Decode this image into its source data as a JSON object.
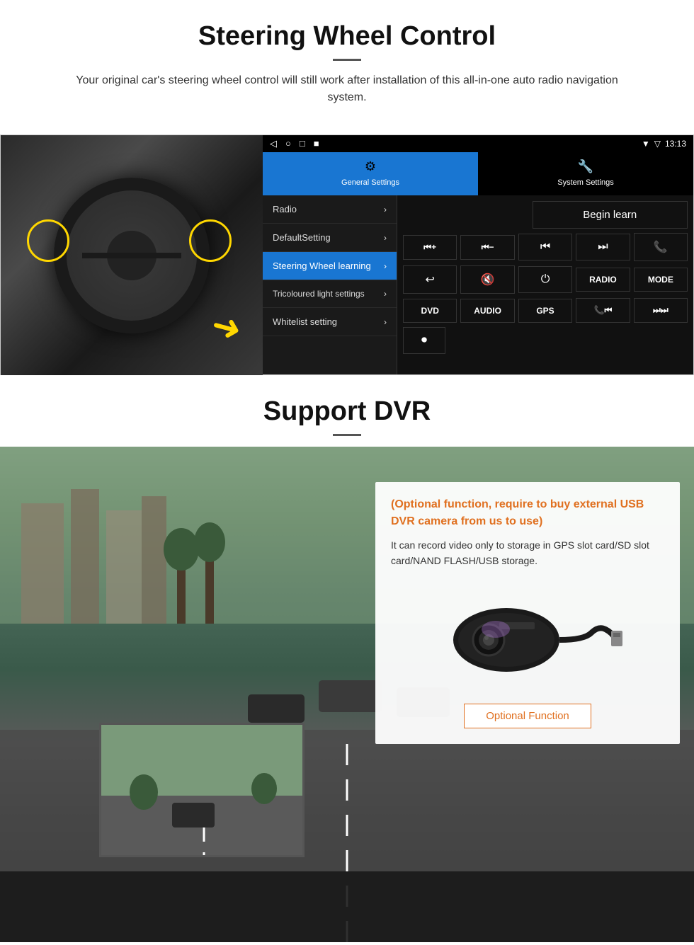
{
  "page": {
    "section1": {
      "title": "Steering Wheel Control",
      "subtitle": "Your original car's steering wheel control will still work after installation of this all-in-one auto radio navigation system.",
      "status_bar": {
        "time": "13:13",
        "nav_icons": [
          "◁",
          "○",
          "□",
          "■"
        ]
      },
      "tabs": [
        {
          "label": "General Settings",
          "icon": "⚙",
          "active": true
        },
        {
          "label": "System Settings",
          "icon": "🔧",
          "active": false
        }
      ],
      "menu_items": [
        {
          "label": "Radio",
          "active": false
        },
        {
          "label": "DefaultSetting",
          "active": false
        },
        {
          "label": "Steering Wheel learning",
          "active": true
        },
        {
          "label": "Tricoloured light settings",
          "active": false
        },
        {
          "label": "Whitelist setting",
          "active": false
        }
      ],
      "begin_learn_label": "Begin learn",
      "control_buttons": [
        [
          "⏮+",
          "⏮−",
          "⏮⏮",
          "⏭⏭",
          "📞"
        ],
        [
          "↩",
          "🔇",
          "⏻",
          "RADIO",
          "MODE"
        ],
        [
          "DVD",
          "AUDIO",
          "GPS",
          "📞⏮",
          "⏭⏭"
        ]
      ]
    },
    "section2": {
      "title": "Support DVR",
      "optional_heading": "(Optional function, require to buy external USB DVR camera from us to use)",
      "description": "It can record video only to storage in GPS slot card/SD slot card/NAND FLASH/USB storage.",
      "optional_btn_label": "Optional Function"
    }
  }
}
